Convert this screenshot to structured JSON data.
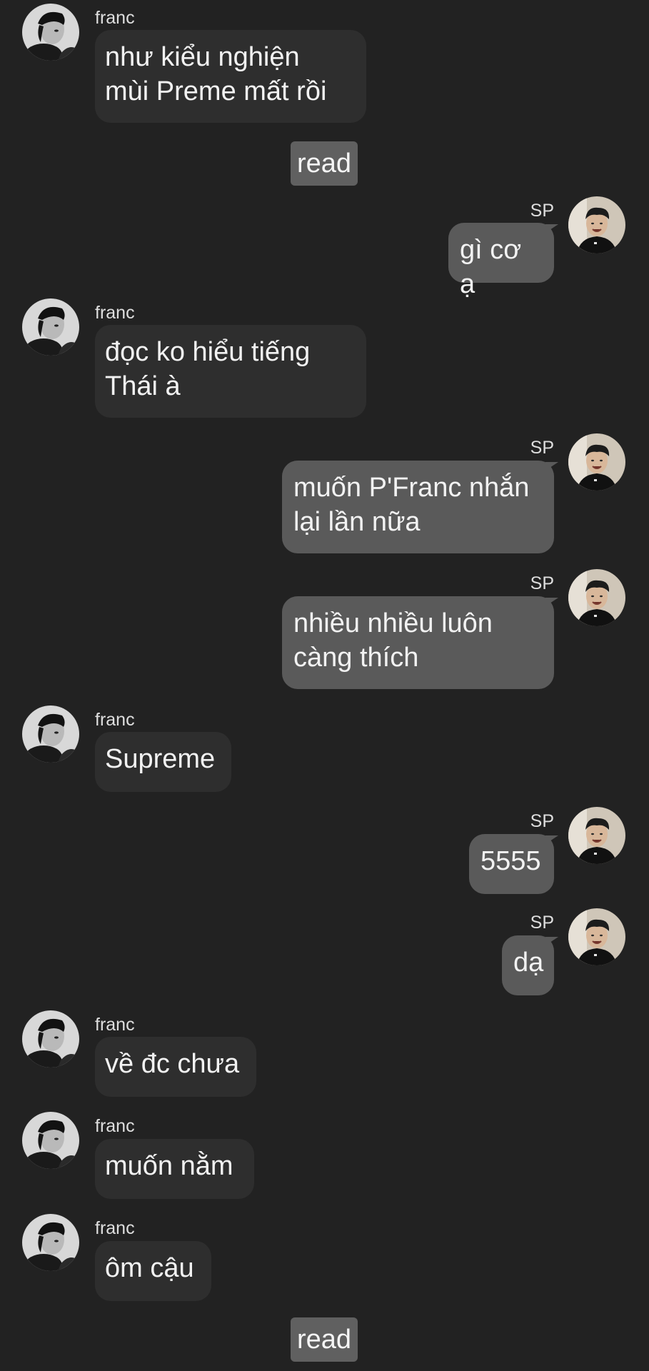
{
  "chat": {
    "participants": {
      "left_name": "franc",
      "right_name": "SP"
    },
    "messages": [
      {
        "sender": "franc",
        "text": "như kiểu nghiện\nmùi Preme mất rồi"
      },
      {
        "sender": "SP",
        "text": "gì cơ ạ"
      },
      {
        "sender": "franc",
        "text": "đọc ko hiểu tiếng\nThái à"
      },
      {
        "sender": "SP",
        "text": "muốn P'Franc nhắn\nlại lần nữa"
      },
      {
        "sender": "SP",
        "text": "nhiều nhiều luôn\ncàng thích"
      },
      {
        "sender": "franc",
        "text": "Supreme"
      },
      {
        "sender": "SP",
        "text": "5555"
      },
      {
        "sender": "SP",
        "text": "dạ"
      },
      {
        "sender": "franc",
        "text": "về đc chưa"
      },
      {
        "sender": "franc",
        "text": "muốn nằm"
      },
      {
        "sender": "franc",
        "text": "ôm cậu"
      }
    ],
    "read_receipts": [
      "read",
      "read"
    ]
  },
  "colors": {
    "background": "#222222",
    "incoming_bubble": "#2e2e2e",
    "outgoing_bubble": "#5a5a5a",
    "read_badge": "#606060"
  },
  "icons": {
    "left_avatar": "avatar-franc-icon",
    "right_avatar": "avatar-sp-icon"
  }
}
